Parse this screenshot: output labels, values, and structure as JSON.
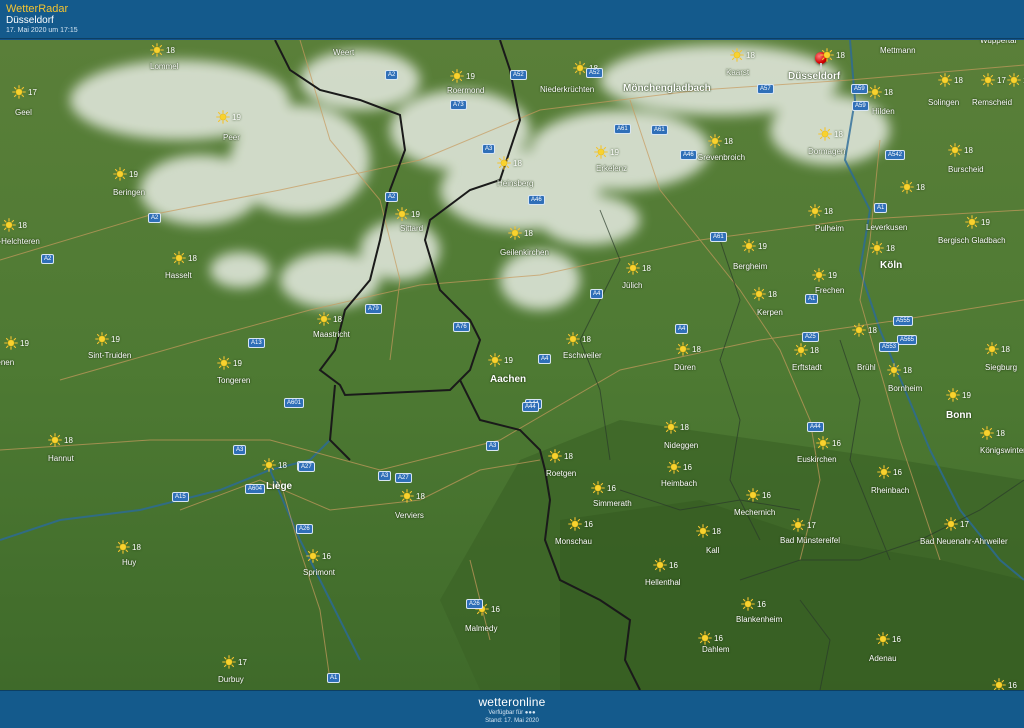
{
  "header": {
    "app_name": "WetterRadar",
    "location": "Düsseldorf",
    "timestamp": "17. Mai 2020 um 17:15"
  },
  "footer": {
    "brand": "wetteronline",
    "available_for": "Verfügbar für",
    "status": "Stand: 17. Mai 2020"
  },
  "colors": {
    "bar": "#145a8c",
    "app_name": "#f4c430",
    "terrain": "#4f7a34",
    "border": "#1a1a1a",
    "road_badge": "#2f6fb8",
    "pin": "#d40000"
  },
  "icons": {
    "weather": "sun-icon",
    "location": "location-pin-icon"
  },
  "cities": [
    {
      "name": "Weert",
      "big": false
    },
    {
      "name": "Lommel",
      "big": false
    },
    {
      "name": "Roermond",
      "big": false
    },
    {
      "name": "Niederkrüchten",
      "big": false
    },
    {
      "name": "Mönchengladbach",
      "big": true
    },
    {
      "name": "Kaarst",
      "big": false
    },
    {
      "name": "Düsseldorf",
      "big": true
    },
    {
      "name": "Mettmann",
      "big": false
    },
    {
      "name": "Geel",
      "big": false
    },
    {
      "name": "Peer",
      "big": false
    },
    {
      "name": "Hilden",
      "big": false
    },
    {
      "name": "Solingen",
      "big": false
    },
    {
      "name": "Remscheid",
      "big": false
    },
    {
      "name": "Dormagen",
      "big": false
    },
    {
      "name": "Grevenbroich",
      "big": false
    },
    {
      "name": "Erkelenz",
      "big": false
    },
    {
      "name": "Heinsberg",
      "big": false
    },
    {
      "name": "Burscheid",
      "big": false
    },
    {
      "name": "Beringen",
      "big": false
    },
    {
      "name": "Leverkusen",
      "big": false
    },
    {
      "name": "Sittard",
      "big": false
    },
    {
      "name": "Pulheim",
      "big": false
    },
    {
      "name": "Bergisch Gladbach",
      "big": false
    },
    {
      "name": "Houthalen-Helchteren",
      "big": false
    },
    {
      "name": "Geilenkirchen",
      "big": false
    },
    {
      "name": "Bergheim",
      "big": false
    },
    {
      "name": "Köln",
      "big": true
    },
    {
      "name": "Hasselt",
      "big": false
    },
    {
      "name": "Jülich",
      "big": false
    },
    {
      "name": "Frechen",
      "big": false
    },
    {
      "name": "Kerpen",
      "big": false
    },
    {
      "name": "Maastricht",
      "big": false
    },
    {
      "name": "Sint-Truiden",
      "big": false
    },
    {
      "name": "Eschweiler",
      "big": false
    },
    {
      "name": "Düren",
      "big": false
    },
    {
      "name": "Erftstadt",
      "big": false
    },
    {
      "name": "Brühl",
      "big": false
    },
    {
      "name": "Siegburg",
      "big": false
    },
    {
      "name": "Tienen",
      "big": false
    },
    {
      "name": "Tongeren",
      "big": false
    },
    {
      "name": "Aachen",
      "big": true
    },
    {
      "name": "Bornheim",
      "big": false
    },
    {
      "name": "Bonn",
      "big": true
    },
    {
      "name": "Nideggen",
      "big": false
    },
    {
      "name": "Euskirchen",
      "big": false
    },
    {
      "name": "Königswinter",
      "big": false
    },
    {
      "name": "Hannut",
      "big": false
    },
    {
      "name": "Liège",
      "big": true
    },
    {
      "name": "Roetgen",
      "big": false
    },
    {
      "name": "Heimbach",
      "big": false
    },
    {
      "name": "Rheinbach",
      "big": false
    },
    {
      "name": "Verviers",
      "big": false
    },
    {
      "name": "Simmerath",
      "big": false
    },
    {
      "name": "Mechernich",
      "big": false
    },
    {
      "name": "Monschau",
      "big": false
    },
    {
      "name": "Bad Münstereifel",
      "big": false
    },
    {
      "name": "Bad Neuenahr-Ahrweiler",
      "big": false
    },
    {
      "name": "Kall",
      "big": false
    },
    {
      "name": "Huy",
      "big": false
    },
    {
      "name": "Sprimont",
      "big": false
    },
    {
      "name": "Hellenthal",
      "big": false
    },
    {
      "name": "Blankenheim",
      "big": false
    },
    {
      "name": "Malmedy",
      "big": false
    },
    {
      "name": "Dahlem",
      "big": false
    },
    {
      "name": "Adenau",
      "big": false
    },
    {
      "name": "Durbuy",
      "big": false
    },
    {
      "name": "Wuppertal",
      "big": false
    }
  ],
  "weather": [
    {
      "temp": "18"
    },
    {
      "temp": "19"
    },
    {
      "temp": "18"
    },
    {
      "temp": "18"
    },
    {
      "temp": "18"
    },
    {
      "temp": "18"
    },
    {
      "temp": "19"
    },
    {
      "temp": "17"
    },
    {
      "temp": "19"
    },
    {
      "temp": "18"
    },
    {
      "temp": "17"
    },
    {
      "temp": "18"
    },
    {
      "temp": "18"
    },
    {
      "temp": "19"
    },
    {
      "temp": "18"
    },
    {
      "temp": "18"
    },
    {
      "temp": "19"
    },
    {
      "temp": "18"
    },
    {
      "temp": "19"
    },
    {
      "temp": "18"
    },
    {
      "temp": "19"
    },
    {
      "temp": "18"
    },
    {
      "temp": "18"
    },
    {
      "temp": "19"
    },
    {
      "temp": "18"
    },
    {
      "temp": "18"
    },
    {
      "temp": "18"
    },
    {
      "temp": "19"
    },
    {
      "temp": "18"
    },
    {
      "temp": "18"
    },
    {
      "temp": "19"
    },
    {
      "temp": "18"
    },
    {
      "temp": "18"
    },
    {
      "temp": "18"
    },
    {
      "temp": "18"
    },
    {
      "temp": "18"
    },
    {
      "temp": "19"
    },
    {
      "temp": "19"
    },
    {
      "temp": "19"
    },
    {
      "temp": "18"
    },
    {
      "temp": "19"
    },
    {
      "temp": "18"
    },
    {
      "temp": "16"
    },
    {
      "temp": "18"
    },
    {
      "temp": "18"
    },
    {
      "temp": "18"
    },
    {
      "temp": "18"
    },
    {
      "temp": "16"
    },
    {
      "temp": "16"
    },
    {
      "temp": "18"
    },
    {
      "temp": "16"
    },
    {
      "temp": "16"
    },
    {
      "temp": "16"
    },
    {
      "temp": "17"
    },
    {
      "temp": "17"
    },
    {
      "temp": "18"
    },
    {
      "temp": "18"
    },
    {
      "temp": "16"
    },
    {
      "temp": "16"
    },
    {
      "temp": "16"
    },
    {
      "temp": "16"
    },
    {
      "temp": "16"
    },
    {
      "temp": "16"
    },
    {
      "temp": "17"
    },
    {
      "temp": "16"
    }
  ],
  "roads": [
    "A2",
    "A52",
    "A73",
    "A61",
    "A57",
    "A46",
    "A59",
    "A3",
    "A542",
    "A1",
    "A44",
    "A4",
    "A555",
    "A565",
    "A553",
    "A76",
    "A79",
    "A13",
    "A601",
    "A604",
    "A15",
    "A26",
    "A25",
    "A27",
    "A44",
    "A4",
    "A61",
    "A3",
    "A3",
    "A4",
    "A1",
    "A2",
    "A2",
    "A2",
    "A61",
    "A59",
    "A3",
    "A46",
    "A52",
    "A44",
    "A1",
    "A26",
    "A27",
    "A25"
  ]
}
